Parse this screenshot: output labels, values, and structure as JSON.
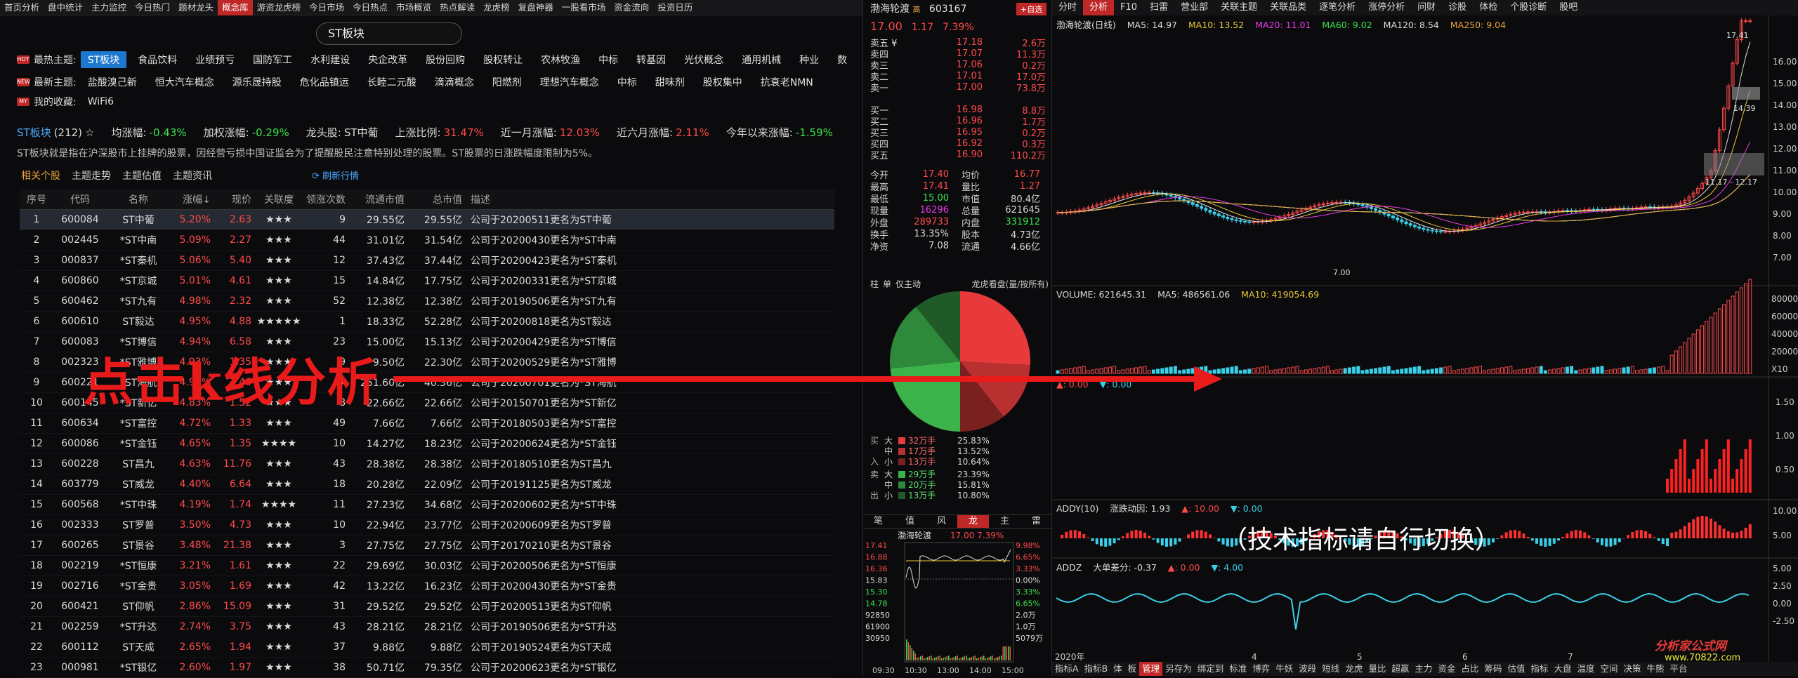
{
  "topnav": [
    "首页分析",
    "盘中统计",
    "主力监控",
    "今日热门",
    "题材龙头",
    "概念库",
    "游资龙虎榜",
    "今日市场",
    "今日热点",
    "市场概览",
    "热点解读",
    "龙虎榜",
    "复盘神器",
    "一股看市场",
    "资金流向",
    "投资日历"
  ],
  "active_nav": "概念库",
  "search": "ST板块",
  "hot": {
    "label": "最热主题:",
    "items": [
      "ST板块",
      "食品饮料",
      "业绩预亏",
      "国防军工",
      "水利建设",
      "央企改革",
      "股份回购",
      "股权转让",
      "农林牧渔",
      "中标",
      "转基因",
      "光伏概念",
      "通用机械",
      "种业",
      "数"
    ]
  },
  "new": {
    "label": "最新主题:",
    "items": [
      "盐酸溴己新",
      "恒大汽车概念",
      "源乐晟持股",
      "危化品镇运",
      "长睦二元酸",
      "滴滴概念",
      "阳燃剂",
      "理想汽车概念",
      "中标",
      "甜味剂",
      "股权集中",
      "抗衰老NMN"
    ]
  },
  "mine": {
    "label": "我的收藏:",
    "items": [
      "WiFi6"
    ]
  },
  "stats": {
    "name": "ST板块",
    "count": "(212)",
    "s1l": "均涨幅:",
    "s1": "-0.43%",
    "s2l": "加权涨幅:",
    "s2": "-0.29%",
    "s3l": "龙头股:",
    "s3": "ST中葡",
    "s4l": "上涨比例:",
    "s4": "31.47%",
    "s5l": "近一月涨幅:",
    "s5": "12.03%",
    "s6l": "近六月涨幅:",
    "s6": "2.11%",
    "s7l": "今年以来涨幅:",
    "s7": "-1.59%"
  },
  "desc": "ST板块就是指在沪深股市上挂牌的股票，因经营亏损中国证监会为了提醒股民注意特别处理的股票。ST股票的日涨跌幅度限制为5%。",
  "subtabs": [
    "相关个股",
    "主题走势",
    "主题估值",
    "主题资讯"
  ],
  "refresh": "刷新行情",
  "columns": [
    "序号",
    "代码",
    "名称",
    "涨幅↓",
    "现价",
    "关联度",
    "领涨次数",
    "流通市值",
    "总市值",
    "描述"
  ],
  "rows": [
    [
      "1",
      "600084",
      "ST中葡",
      "5.20%",
      "2.63",
      "★★★",
      "9",
      "29.55亿",
      "29.55亿",
      "公司于20200511更名为ST中葡"
    ],
    [
      "2",
      "002445",
      "*ST中南",
      "5.09%",
      "2.27",
      "★★★",
      "44",
      "31.01亿",
      "31.54亿",
      "公司于20200430更名为*ST中南"
    ],
    [
      "3",
      "000837",
      "*ST秦机",
      "5.06%",
      "5.40",
      "★★★",
      "12",
      "37.43亿",
      "37.44亿",
      "公司于20200423更名为*ST秦机"
    ],
    [
      "4",
      "600860",
      "*ST京城",
      "5.01%",
      "4.61",
      "★★★",
      "15",
      "14.84亿",
      "17.75亿",
      "公司于20200331更名为*ST京城"
    ],
    [
      "5",
      "600462",
      "*ST九有",
      "4.98%",
      "2.32",
      "★★★",
      "52",
      "12.38亿",
      "12.38亿",
      "公司于20190506更名为*ST九有"
    ],
    [
      "6",
      "600610",
      "ST毅达",
      "4.95%",
      "4.88",
      "★★★★★",
      "1",
      "18.33亿",
      "52.28亿",
      "公司于20200818更名为ST毅达"
    ],
    [
      "7",
      "600083",
      "*ST博信",
      "4.94%",
      "6.58",
      "★★★",
      "23",
      "15.00亿",
      "15.13亿",
      "公司于20200429更名为*ST博信"
    ],
    [
      "8",
      "002323",
      "*ST雅博",
      "4.93%",
      "1.35",
      "★★★",
      "9",
      "9.50亿",
      "22.30亿",
      "公司于20200529更名为*ST雅博"
    ],
    [
      "9",
      "600221",
      "*ST海航",
      "4.92%",
      "1.46",
      "★★★",
      "7",
      "251.60亿",
      "40.36亿",
      "公司于20200701更名为*ST海航"
    ],
    [
      "10",
      "600145",
      "*ST新亿",
      "4.83%",
      "1.52",
      "★★★",
      "8",
      "22.66亿",
      "22.66亿",
      "公司于20150701更名为*ST新亿"
    ],
    [
      "11",
      "600634",
      "*ST富控",
      "4.72%",
      "1.33",
      "★★★",
      "49",
      "7.66亿",
      "7.66亿",
      "公司于20180503更名为*ST富控"
    ],
    [
      "12",
      "600086",
      "*ST金钰",
      "4.65%",
      "1.35",
      "★★★★",
      "10",
      "14.27亿",
      "18.23亿",
      "公司于20200624更名为*ST金钰"
    ],
    [
      "13",
      "600228",
      "ST昌九",
      "4.63%",
      "11.76",
      "★★★",
      "43",
      "28.38亿",
      "28.38亿",
      "公司于20180510更名为ST昌九"
    ],
    [
      "14",
      "603779",
      "ST威龙",
      "4.40%",
      "6.64",
      "★★★",
      "18",
      "20.28亿",
      "22.09亿",
      "公司于20191125更名为ST威龙"
    ],
    [
      "15",
      "600568",
      "*ST中珠",
      "4.19%",
      "1.74",
      "★★★★",
      "11",
      "27.23亿",
      "34.68亿",
      "公司于20200602更名为*ST中珠"
    ],
    [
      "16",
      "002333",
      "ST罗普",
      "3.50%",
      "4.73",
      "★★★",
      "10",
      "22.94亿",
      "23.77亿",
      "公司于20200609更名为ST罗普"
    ],
    [
      "17",
      "600265",
      "ST景谷",
      "3.48%",
      "21.38",
      "★★★",
      "3",
      "27.75亿",
      "27.75亿",
      "公司于20170210更名为ST景谷"
    ],
    [
      "18",
      "002219",
      "*ST恒康",
      "3.21%",
      "1.61",
      "★★★",
      "22",
      "29.69亿",
      "30.03亿",
      "公司于20200506更名为*ST恒康"
    ],
    [
      "19",
      "002716",
      "*ST金贵",
      "3.05%",
      "1.69",
      "★★★",
      "42",
      "13.22亿",
      "16.23亿",
      "公司于20200430更名为*ST金贵"
    ],
    [
      "20",
      "600421",
      "ST仰帆",
      "2.86%",
      "15.09",
      "★★★",
      "31",
      "29.52亿",
      "29.52亿",
      "公司于20200513更名为ST仰帆"
    ],
    [
      "21",
      "002259",
      "*ST升达",
      "2.74%",
      "3.75",
      "★★★",
      "43",
      "28.21亿",
      "28.21亿",
      "公司于20190506更名为*ST升达"
    ],
    [
      "22",
      "600112",
      "ST天成",
      "2.65%",
      "1.94",
      "★★★",
      "37",
      "9.88亿",
      "9.88亿",
      "公司于20190524更名为ST天成"
    ],
    [
      "23",
      "000981",
      "*ST银亿",
      "2.60%",
      "1.97",
      "★★★",
      "38",
      "50.71亿",
      "79.35亿",
      "公司于20200623更名为*ST银亿"
    ]
  ],
  "overlay1": "点击k线分析",
  "overlay2": "（技术指标请自行切换）",
  "quote": {
    "name": "渤海轮渡",
    "tag": "高",
    "code": "603167",
    "price": "17.00",
    "chg": "1.17",
    "pct": "7.39%",
    "btn": "+自选"
  },
  "asks": [
    [
      "卖五 ¥",
      "17.18",
      "2.6万"
    ],
    [
      "卖四",
      "17.07",
      "11.3万"
    ],
    [
      "卖三",
      "17.06",
      "0.2万"
    ],
    [
      "卖二",
      "17.01",
      "17.0万"
    ],
    [
      "卖一",
      "17.00",
      "73.8万"
    ]
  ],
  "bids": [
    [
      "买一",
      "16.98",
      "8.8万"
    ],
    [
      "买二",
      "16.96",
      "1.7万"
    ],
    [
      "买三",
      "16.95",
      "0.2万"
    ],
    [
      "买四",
      "16.92",
      "0.3万"
    ],
    [
      "买五",
      "16.90",
      "110.2万"
    ]
  ],
  "kv": [
    [
      "今开",
      "17.40",
      "均价",
      "16.77"
    ],
    [
      "最高",
      "17.41",
      "量比",
      "1.27"
    ],
    [
      "最低",
      "15.00",
      "市值",
      "80.4亿"
    ],
    [
      "现量",
      "16296",
      "总量",
      "621645"
    ],
    [
      "外盘",
      "289733",
      "内盘",
      "331912"
    ],
    [
      "换手",
      "13.35%",
      "股本",
      "4.73亿"
    ],
    [
      "净资",
      "7.08",
      "流通",
      "4.66亿"
    ]
  ],
  "pietitle": {
    "a": "柱",
    "b": "单",
    "c": "仅主动",
    "d": "龙虎看盘(量/按所有)"
  },
  "flow": [
    [
      "买",
      "大",
      "32万手",
      "25.83%",
      "#e83a3a"
    ],
    [
      "",
      "中",
      "17万手",
      "13.52%",
      "#b83030"
    ],
    [
      "入",
      "小",
      "13万手",
      "10.64%",
      "#7a2020"
    ],
    [
      "卖",
      "大",
      "29万手",
      "23.39%",
      "#3cb34a"
    ],
    [
      "",
      "中",
      "20万手",
      "15.81%",
      "#2e8a3a"
    ],
    [
      "出",
      "小",
      "13万手",
      "10.80%",
      "#1f5a28"
    ]
  ],
  "bottabs": [
    "笔",
    "值",
    "风",
    "龙",
    "主",
    "雷"
  ],
  "mini": {
    "title": "渤海轮渡",
    "tp": "17.00 7.39%",
    "l": [
      "17.41",
      "16.88",
      "16.36",
      "15.83",
      "15.30",
      "14.78",
      "92850",
      "61900",
      "30950"
    ],
    "r": [
      "9.98%",
      "6.65%",
      "3.33%",
      "0.00%",
      "3.33%",
      "6.65%",
      "2.0万",
      "1.0万",
      "5079万"
    ],
    "t": [
      "09:30",
      "10:30",
      "13:00",
      "14:00",
      "15:00"
    ]
  },
  "rtabs": [
    "分时",
    "分析",
    "F10",
    "扫雷",
    "营业部",
    "关联主题",
    "关联品类",
    "逐笔分析",
    "涨停分析",
    "问财",
    "诊股",
    "体检",
    "个股诊断",
    "股吧"
  ],
  "ma": {
    "t": "渤海轮渡(日线)",
    "ma5": "MA5: 14.97",
    "ma10": "MA10: 13.52",
    "ma20": "MA20: 11.01",
    "ma60": "MA60: 9.02",
    "ma120": "MA120: 8.54",
    "ma250": "MA250: 9.04"
  },
  "kaxis": [
    "16.00",
    "15.00",
    "14.00",
    "13.00",
    "12.00",
    "11.00",
    "10.00",
    "9.00",
    "8.00",
    "7.00"
  ],
  "klabels": {
    "high": "17.41",
    "low": "7.00",
    "bx1": "14.39",
    "bx2": "11.17 - 12.17"
  },
  "vol": {
    "t": "VOLUME: 621645.31",
    "ma5": "MA5: 486561.06",
    "ma10": "MA10: 419054.69",
    "axis": [
      "80000",
      "60000",
      "40000",
      "20000",
      "X10"
    ]
  },
  "ind2": {
    "a": "▲: 0.00",
    "b": "▼: 0.00",
    "axis": [
      "1.50",
      "1.00",
      "0.50"
    ]
  },
  "addy": {
    "t": "ADDY(10)",
    "b": "涨跌动因: 1.93",
    "c": "▲: 10.00",
    "d": "▼: 0.00",
    "axis": [
      "10.00",
      "5.00"
    ]
  },
  "addz": {
    "t": "ADDZ",
    "b": "大单差分: -0.37",
    "c": "▲: 0.00",
    "d": "▼: 4.00",
    "axis": [
      "5.00",
      "2.50",
      "0.00",
      "-2.50"
    ]
  },
  "xaxis": [
    "2020年",
    "4",
    "5",
    "6",
    "7"
  ],
  "btabs": [
    "指标A",
    "指标B",
    "体",
    "板",
    "管理",
    "另存为",
    "绑定到",
    "标准",
    "博弈",
    "牛妖",
    "波段",
    "短线",
    "龙虎",
    "量比",
    "超赢",
    "主力",
    "资金",
    "占比",
    "筹码",
    "估值",
    "指标",
    "大盘",
    "温度",
    "空间",
    "决策",
    "牛熊",
    "平台"
  ],
  "wm1": "分析家公式网",
  "wm2": "www.70822.com"
}
